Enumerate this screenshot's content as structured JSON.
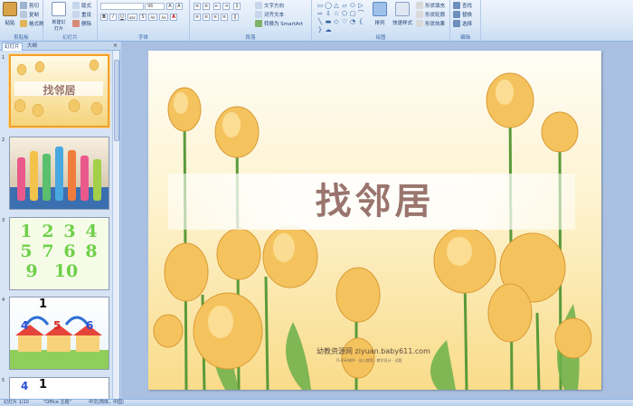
{
  "ribbon": {
    "clipboard": {
      "group_label": "剪贴板",
      "paste": "粘贴",
      "cut": "剪切",
      "copy": "复制",
      "format_painter": "格式刷"
    },
    "slides": {
      "group_label": "幻灯片",
      "new_slide": "新建幻灯片",
      "layout": "版式",
      "reset": "重设",
      "delete": "删除"
    },
    "font": {
      "group_label": "字体",
      "font_size": "96",
      "bold": "B",
      "italic": "I",
      "underline": "U",
      "strike": "abc",
      "shadow": "S",
      "spacing": "AV",
      "case": "Aa",
      "color": "A"
    },
    "paragraph": {
      "group_label": "段落",
      "text_direction": "文字方向",
      "align_text": "对齐文本",
      "smartart": "转换为 SmartArt"
    },
    "drawing": {
      "group_label": "绘图",
      "arrange": "排列",
      "quick_styles": "快速样式",
      "shape_fill": "形状填充",
      "shape_outline": "形状轮廓",
      "shape_effects": "形状效果",
      "shapes": [
        "▭",
        "◯",
        "△",
        "▱",
        "⬭",
        "▷",
        "⇨",
        "⇩",
        "☆",
        "⬠",
        "▢",
        "⌒",
        "╲",
        "▬",
        "◇",
        "♡",
        "◔",
        "{",
        "}",
        "☁"
      ]
    },
    "editing": {
      "group_label": "编辑",
      "find": "查找",
      "replace": "替换",
      "select": "选择"
    }
  },
  "pane": {
    "tabs": [
      "幻灯片",
      "大纲"
    ],
    "close": "×",
    "thumbs": [
      {
        "num": "1",
        "title": "找邻居"
      },
      {
        "num": "2"
      },
      {
        "num": "3",
        "digits": [
          "1",
          "2",
          "3",
          "4",
          "5",
          "7",
          "6",
          "8",
          "9",
          "10"
        ]
      },
      {
        "num": "4",
        "labels": [
          "1",
          "4",
          "5",
          "6"
        ]
      },
      {
        "num": "5",
        "labels": [
          "1",
          "4"
        ]
      }
    ]
  },
  "slide": {
    "title": "找邻居",
    "watermark": "幼教资源网 ziyuan.baby611.com",
    "watermark_sub": "FLASH课件 · 幼儿教案 · 教学设计 · 试题"
  },
  "status": {
    "slide_info": "幻灯片 1/10",
    "theme": "\"Office 主题\"",
    "language": "中文(简体，中国)"
  },
  "colors": {
    "accent": "#f2a12c",
    "title": "#9a756d",
    "ribbon": "#dbe8f7"
  }
}
